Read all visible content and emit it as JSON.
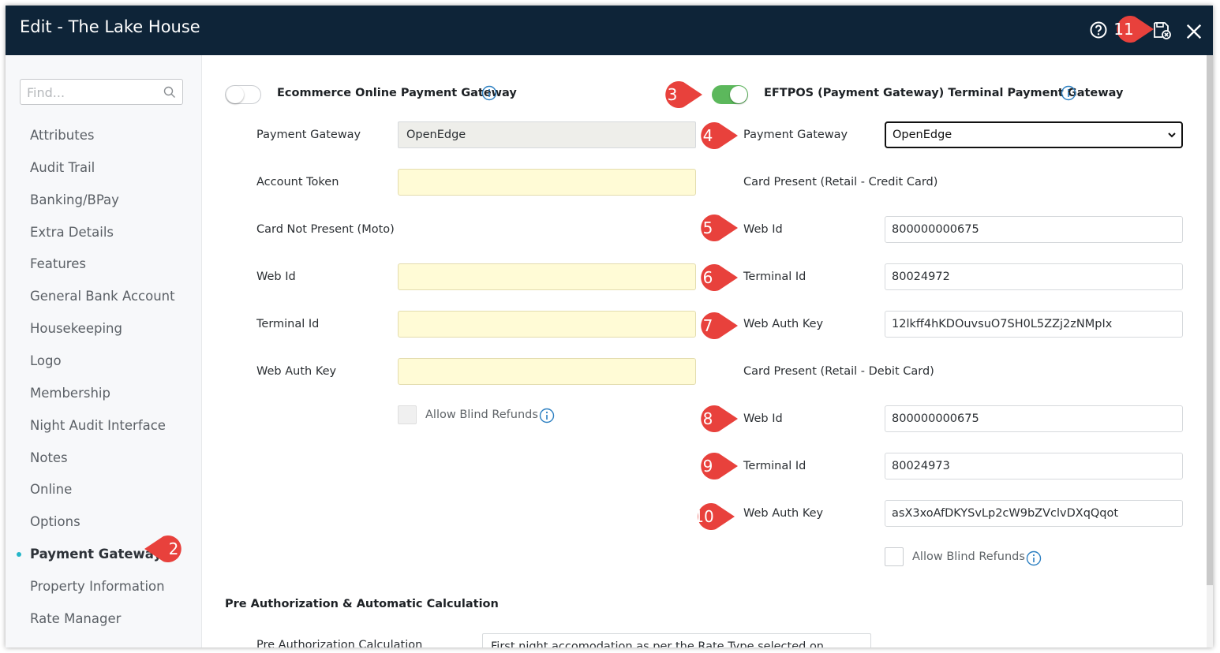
{
  "window": {
    "title": "Edit - The Lake House"
  },
  "search": {
    "placeholder": "Find..."
  },
  "sidebar": {
    "items": [
      {
        "label": "Attributes"
      },
      {
        "label": "Audit Trail"
      },
      {
        "label": "Banking/BPay"
      },
      {
        "label": "Extra Details"
      },
      {
        "label": "Features"
      },
      {
        "label": "General Bank Account"
      },
      {
        "label": "Housekeeping"
      },
      {
        "label": "Logo"
      },
      {
        "label": "Membership"
      },
      {
        "label": "Night Audit Interface"
      },
      {
        "label": "Notes"
      },
      {
        "label": "Online"
      },
      {
        "label": "Options"
      },
      {
        "label": "Payment Gateway",
        "active": true
      },
      {
        "label": "Property Information"
      },
      {
        "label": "Rate Manager"
      }
    ]
  },
  "ecommerce": {
    "toggle_label": "Ecommerce Online Payment Gateway",
    "enabled": false,
    "payment_gateway_label": "Payment Gateway",
    "payment_gateway_value": "OpenEdge",
    "account_token_label": "Account Token",
    "account_token_value": "",
    "card_not_present_label": "Card Not Present (Moto)",
    "web_id_label": "Web Id",
    "web_id_value": "",
    "terminal_id_label": "Terminal Id",
    "terminal_id_value": "",
    "web_auth_key_label": "Web Auth Key",
    "web_auth_key_value": "",
    "allow_blind_refunds_label": "Allow Blind Refunds",
    "allow_blind_refunds_checked": false
  },
  "eftpos": {
    "toggle_label": "EFTPOS (Payment Gateway) Terminal Payment Gateway",
    "enabled": true,
    "payment_gateway_label": "Payment Gateway",
    "payment_gateway_value": "OpenEdge",
    "credit_section_label": "Card Present (Retail - Credit Card)",
    "credit_web_id_label": "Web Id",
    "credit_web_id_value": "800000000675",
    "credit_terminal_id_label": "Terminal Id",
    "credit_terminal_id_value": "80024972",
    "credit_web_auth_key_label": "Web Auth Key",
    "credit_web_auth_key_value": "12lkff4hKDOuvsuO7SH0L5ZZj2zNMpIx",
    "debit_section_label": "Card Present (Retail - Debit Card)",
    "debit_web_id_label": "Web Id",
    "debit_web_id_value": "800000000675",
    "debit_terminal_id_label": "Terminal Id",
    "debit_terminal_id_value": "80024973",
    "debit_web_auth_key_label": "Web Auth Key",
    "debit_web_auth_key_value": "asX3xoAfDKYSvLp2cW9bZVclvDXqQqot",
    "allow_blind_refunds_label": "Allow Blind Refunds",
    "allow_blind_refunds_checked": false
  },
  "preauth": {
    "section_label": "Pre Authorization & Automatic Calculation",
    "calc_label": "Pre Authorization Calculation",
    "calc_value": "First night accomodation as per the Rate Type selected on Reservation"
  },
  "annotations": [
    "2",
    "3",
    "4",
    "5",
    "6",
    "7",
    "8",
    "9",
    "10",
    "11"
  ],
  "colors": {
    "titlebar": "#0e2438",
    "toggle_on": "#5cb85c",
    "badge": "#e8413c",
    "info": "#2c7fc1",
    "active_dot": "#25b6c8",
    "yellow_field": "#fffbd6"
  }
}
